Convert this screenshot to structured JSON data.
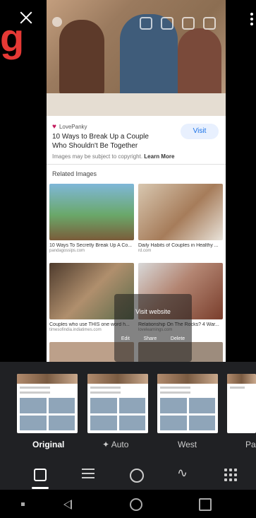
{
  "header": {
    "logo_text": "g"
  },
  "result": {
    "source": "LovePanky",
    "title": "10 Ways to Break Up a Couple Who Shouldn't Be Together",
    "visit_label": "Visit",
    "copyright": "Images may be subject to copyright.",
    "learn_more": "Learn More",
    "related_heading": "Related Images"
  },
  "related": [
    {
      "caption": "10 Ways To Secretly Break Up A Co...",
      "domain": "pandagossips.com"
    },
    {
      "caption": "Daily Habits of Couples in Healthy ...",
      "domain": "rd.com"
    },
    {
      "caption": "Couples who use THIS one word h...",
      "domain": "timesofindia.indiatimes.com"
    },
    {
      "caption": "Relationship On The Rocks? 4 War...",
      "domain": "lovelearnings.com"
    }
  ],
  "overlay": {
    "visit_website": "Visit website",
    "edit": "Edit",
    "share": "Share",
    "delete": "Delete"
  },
  "filters": {
    "original": "Original",
    "auto": "Auto",
    "west": "West",
    "palma": "Pa"
  },
  "colors": {
    "accent": "#1a73e8",
    "logo": "#e53935",
    "toolbar_bg": "#202124"
  }
}
